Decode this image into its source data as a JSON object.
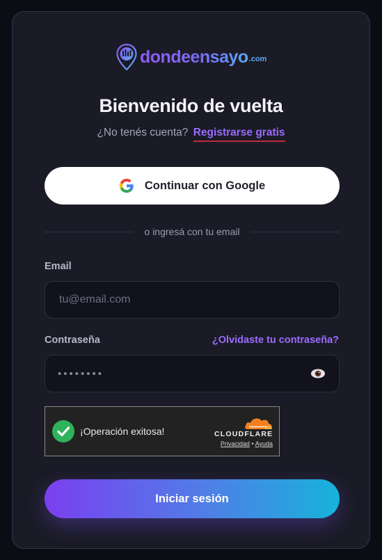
{
  "logo": {
    "name": "dondeensayo",
    "tld": ".com"
  },
  "title": "Bienvenido de vuelta",
  "subtitle": {
    "text": "¿No tenés cuenta?",
    "register_link": "Registrarse gratis"
  },
  "google_button": {
    "label": "Continuar con Google",
    "icon": "google-icon"
  },
  "divider_text": "o ingresá con tu email",
  "email": {
    "label": "Email",
    "placeholder": "tu@email.com",
    "value": ""
  },
  "password": {
    "label": "Contraseña",
    "forgot_link": "¿Olvidaste tu contraseña?",
    "masked_value": "••••••••",
    "icon": "eye-icon"
  },
  "captcha": {
    "status": "¡Operación exitosa!",
    "provider": "CLOUDFLARE",
    "privacy": "Privacidad",
    "separator": "•",
    "help": "Ayuda"
  },
  "submit_label": "Iniciar sesión",
  "colors": {
    "accent": "#9b6bff",
    "gradient_start": "#7b3ff0",
    "gradient_end": "#17b3da",
    "success": "#2fb35a",
    "cloudflare_orange": "#f38020"
  }
}
